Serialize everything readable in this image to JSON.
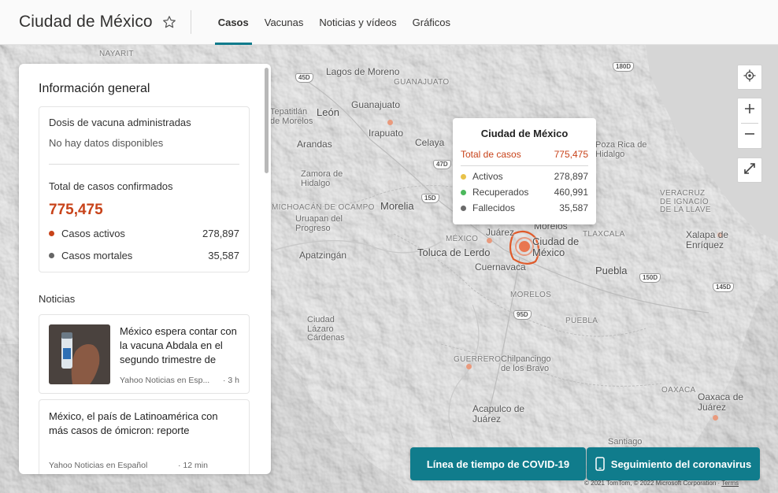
{
  "header": {
    "title": "Ciudad de México",
    "tabs": [
      {
        "label": "Casos",
        "active": true
      },
      {
        "label": "Vacunas",
        "active": false
      },
      {
        "label": "Noticias y vídeos",
        "active": false
      },
      {
        "label": "Gráficos",
        "active": false
      }
    ]
  },
  "panel": {
    "title": "Información general",
    "vaccine_label": "Dosis de vacuna administradas",
    "vaccine_value": "No hay datos disponibles",
    "confirmed_label": "Total de casos confirmados",
    "confirmed_value": "775,475",
    "active_label": "Casos activos",
    "active_value": "278,897",
    "deaths_label": "Casos mortales",
    "deaths_value": "35,587",
    "news_heading": "Noticias",
    "news": [
      {
        "title": "México espera contar con la vacuna Abdala en el segundo trimestre de",
        "source": "Yahoo Noticias en Esp...",
        "age": "3 h"
      },
      {
        "title": "México, el país de Latinoamérica con más casos de ómicron: reporte",
        "source": "Yahoo Noticias en Español",
        "age": "12 min"
      }
    ]
  },
  "tooltip": {
    "title": "Ciudad de México",
    "total_label": "Total de casos",
    "total_value": "775,475",
    "rows": [
      {
        "label": "Activos",
        "value": "278,897",
        "color": "#e8c24a"
      },
      {
        "label": "Recuperados",
        "value": "460,991",
        "color": "#4cb85c"
      },
      {
        "label": "Fallecidos",
        "value": "35,587",
        "color": "#6b6b6b"
      }
    ]
  },
  "buttons": {
    "timeline": "Línea de tiempo de COVID-19",
    "tracker": "Seguimiento del coronavirus"
  },
  "copyright": {
    "text": "© 2021 TomTom, © 2022 Microsoft Corporation",
    "terms": "Terms"
  },
  "map": {
    "labels": [
      "NAYARIT",
      "Lagos de Moreno",
      "GUANAJUATO",
      "León",
      "Guanajuato",
      "Tepatitlán de Morelos",
      "Irapuato",
      "Celaya",
      "Arandas",
      "Zamora de Hidalgo",
      "Poza Rica de Hidalgo",
      "MICHOACÁN DE OCAMPO",
      "Uruapan del Progreso",
      "Morelia",
      "VERACRUZ DE IGNACIO DE LA LLAVE",
      "Apatzingán",
      "MÉXICO",
      "Toluca de Lerdo",
      "Cuernavaca",
      "Ciudad de México",
      "Morelos",
      "TLAXCALA",
      "Xalapa de Enríquez",
      "Puebla",
      "MORELOS",
      "PUEBLA",
      "Ciudad Lázaro Cárdenas",
      "GUERRERO",
      "Chilpancingo de los Bravo",
      "Acapulco de Juárez",
      "OAXACA",
      "Oaxaca de Juárez",
      "Santiago",
      "Juárez",
      "Celaya"
    ],
    "highways": [
      "45D",
      "180D",
      "15D",
      "47D",
      "150D",
      "145D",
      "95D"
    ]
  },
  "colors": {
    "accent": "#0f7b8c",
    "cta": "#107c8c",
    "cases": "#c8431a",
    "active_dot": "#c8431a",
    "deaths_dot": "#666666"
  }
}
